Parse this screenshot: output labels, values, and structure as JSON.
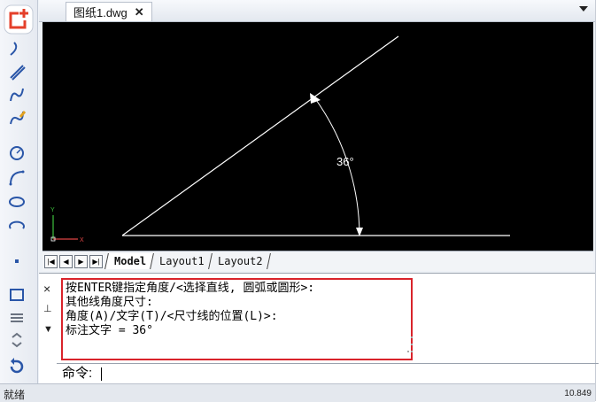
{
  "tab": {
    "title": "图纸1.dwg",
    "close": "✕"
  },
  "toolbar": {
    "icons": [
      "line-icon",
      "polyline-icon",
      "spline-icon",
      "arc-icon",
      "circle-icon",
      "arc3-icon",
      "ellipse-icon",
      "ellipse-arc-icon",
      "point-icon",
      "rect-icon",
      "hatch-icon",
      "more-icon",
      "undo-icon"
    ]
  },
  "drawing": {
    "background": "#000000",
    "dimension_text": "36°",
    "ucs": {
      "x": "X",
      "y": "Y"
    }
  },
  "layout_tabs": {
    "nav": [
      "|◀",
      "◀",
      "▶",
      "▶|"
    ],
    "tabs": [
      {
        "label": "Model",
        "active": true
      },
      {
        "label": "Layout1",
        "active": false
      },
      {
        "label": "Layout2",
        "active": false
      }
    ]
  },
  "command": {
    "side": {
      "close": "×",
      "pin": "⊥",
      "menu": "▼"
    },
    "history": [
      "按ENTER键指定角度/<选择直线, 圆弧或圆形>:",
      "其他线角度尺寸:",
      "角度(A)/文字(T)/<尺寸线的位置(L)>:",
      "标注文字 = 36°"
    ],
    "prompt": "命令:",
    "highlight_color": "#d9232b"
  },
  "status": {
    "left": "就绪",
    "right": "10.849"
  }
}
